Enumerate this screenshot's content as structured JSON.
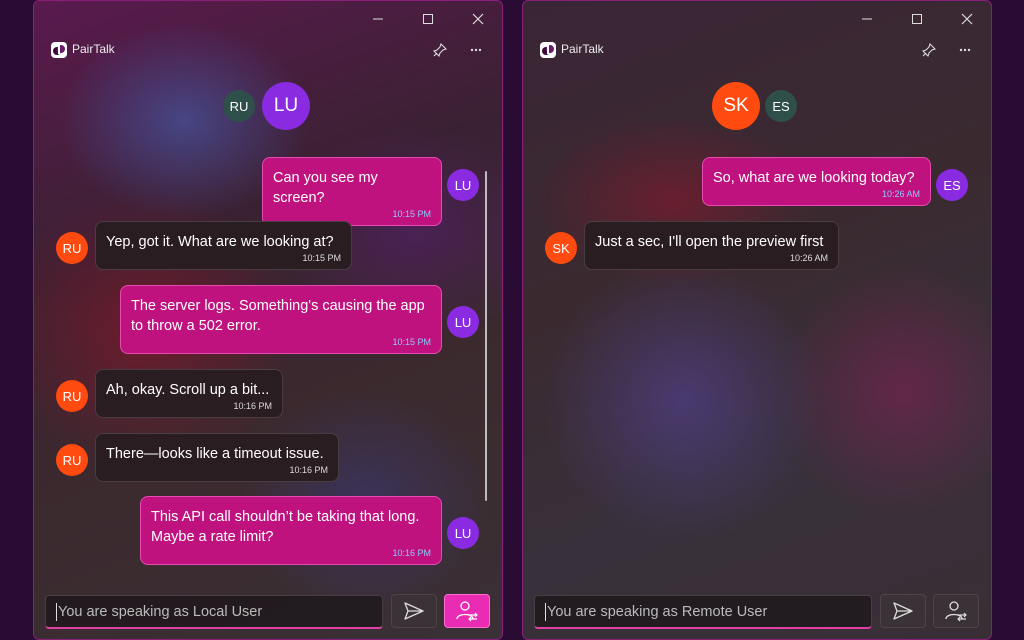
{
  "colors": {
    "outgoing_bubble": "#c0127e",
    "incoming_bubble": "#2a1d22",
    "accent_pink": "#ea2bb3",
    "avatar_purple": "#8a2be2",
    "avatar_orange": "#ff4a10",
    "avatar_slate": "#2f4f4a",
    "outgoing_time": "#8fc8ff"
  },
  "left": {
    "app_title": "PairTalk",
    "header_avatars": {
      "other": "RU",
      "self": "LU"
    },
    "messages": [
      {
        "dir": "out",
        "avatar": "LU",
        "lines": [
          "Can you see my screen?"
        ],
        "time": "10:15 PM"
      },
      {
        "dir": "in",
        "avatar": "RU",
        "lines": [
          "Yep, got it. What are we looking at?"
        ],
        "time": "10:15 PM"
      },
      {
        "dir": "out",
        "avatar": "LU",
        "lines": [
          "The server logs. Something's causing the app",
          "to throw a 502 error."
        ],
        "time": "10:15 PM"
      },
      {
        "dir": "in",
        "avatar": "RU",
        "lines": [
          "Ah, okay. Scroll up a bit..."
        ],
        "time": "10:16 PM"
      },
      {
        "dir": "in",
        "avatar": "RU",
        "lines": [
          "There—looks like a timeout issue."
        ],
        "time": "10:16 PM"
      },
      {
        "dir": "out",
        "avatar": "LU",
        "lines": [
          "This API call shouldn’t be taking that long.",
          "Maybe a rate limit?"
        ],
        "time": "10:16 PM"
      }
    ],
    "input_placeholder": "You are speaking as Local User",
    "send_icon": "send-icon",
    "switch_icon": "switch-user-icon"
  },
  "right": {
    "app_title": "PairTalk",
    "header_avatars": {
      "self": "SK",
      "other": "ES"
    },
    "messages": [
      {
        "dir": "out",
        "avatar": "ES",
        "lines": [
          "So, what are we looking today?"
        ],
        "time": "10:26 AM"
      },
      {
        "dir": "in",
        "avatar": "SK",
        "lines": [
          "Just a sec, I'll open the preview first"
        ],
        "time": "10:26 AM"
      }
    ],
    "input_placeholder": "You are speaking as Remote User",
    "send_icon": "send-icon",
    "switch_icon": "switch-user-icon"
  }
}
